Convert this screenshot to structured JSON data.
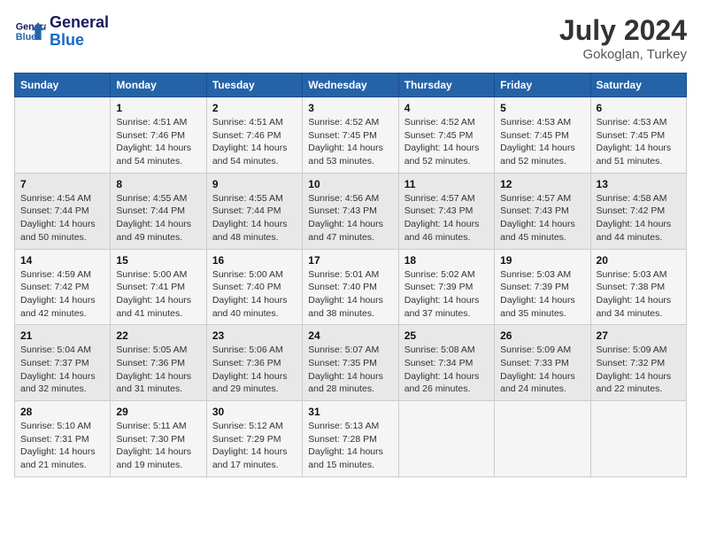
{
  "logo": {
    "line1": "General",
    "line2": "Blue"
  },
  "title": {
    "month_year": "July 2024",
    "location": "Gokoglan, Turkey"
  },
  "days_of_week": [
    "Sunday",
    "Monday",
    "Tuesday",
    "Wednesday",
    "Thursday",
    "Friday",
    "Saturday"
  ],
  "weeks": [
    [
      {
        "day": "",
        "sunrise": "",
        "sunset": "",
        "daylight": ""
      },
      {
        "day": "1",
        "sunrise": "Sunrise: 4:51 AM",
        "sunset": "Sunset: 7:46 PM",
        "daylight": "Daylight: 14 hours and 54 minutes."
      },
      {
        "day": "2",
        "sunrise": "Sunrise: 4:51 AM",
        "sunset": "Sunset: 7:46 PM",
        "daylight": "Daylight: 14 hours and 54 minutes."
      },
      {
        "day": "3",
        "sunrise": "Sunrise: 4:52 AM",
        "sunset": "Sunset: 7:45 PM",
        "daylight": "Daylight: 14 hours and 53 minutes."
      },
      {
        "day": "4",
        "sunrise": "Sunrise: 4:52 AM",
        "sunset": "Sunset: 7:45 PM",
        "daylight": "Daylight: 14 hours and 52 minutes."
      },
      {
        "day": "5",
        "sunrise": "Sunrise: 4:53 AM",
        "sunset": "Sunset: 7:45 PM",
        "daylight": "Daylight: 14 hours and 52 minutes."
      },
      {
        "day": "6",
        "sunrise": "Sunrise: 4:53 AM",
        "sunset": "Sunset: 7:45 PM",
        "daylight": "Daylight: 14 hours and 51 minutes."
      }
    ],
    [
      {
        "day": "7",
        "sunrise": "Sunrise: 4:54 AM",
        "sunset": "Sunset: 7:44 PM",
        "daylight": "Daylight: 14 hours and 50 minutes."
      },
      {
        "day": "8",
        "sunrise": "Sunrise: 4:55 AM",
        "sunset": "Sunset: 7:44 PM",
        "daylight": "Daylight: 14 hours and 49 minutes."
      },
      {
        "day": "9",
        "sunrise": "Sunrise: 4:55 AM",
        "sunset": "Sunset: 7:44 PM",
        "daylight": "Daylight: 14 hours and 48 minutes."
      },
      {
        "day": "10",
        "sunrise": "Sunrise: 4:56 AM",
        "sunset": "Sunset: 7:43 PM",
        "daylight": "Daylight: 14 hours and 47 minutes."
      },
      {
        "day": "11",
        "sunrise": "Sunrise: 4:57 AM",
        "sunset": "Sunset: 7:43 PM",
        "daylight": "Daylight: 14 hours and 46 minutes."
      },
      {
        "day": "12",
        "sunrise": "Sunrise: 4:57 AM",
        "sunset": "Sunset: 7:43 PM",
        "daylight": "Daylight: 14 hours and 45 minutes."
      },
      {
        "day": "13",
        "sunrise": "Sunrise: 4:58 AM",
        "sunset": "Sunset: 7:42 PM",
        "daylight": "Daylight: 14 hours and 44 minutes."
      }
    ],
    [
      {
        "day": "14",
        "sunrise": "Sunrise: 4:59 AM",
        "sunset": "Sunset: 7:42 PM",
        "daylight": "Daylight: 14 hours and 42 minutes."
      },
      {
        "day": "15",
        "sunrise": "Sunrise: 5:00 AM",
        "sunset": "Sunset: 7:41 PM",
        "daylight": "Daylight: 14 hours and 41 minutes."
      },
      {
        "day": "16",
        "sunrise": "Sunrise: 5:00 AM",
        "sunset": "Sunset: 7:40 PM",
        "daylight": "Daylight: 14 hours and 40 minutes."
      },
      {
        "day": "17",
        "sunrise": "Sunrise: 5:01 AM",
        "sunset": "Sunset: 7:40 PM",
        "daylight": "Daylight: 14 hours and 38 minutes."
      },
      {
        "day": "18",
        "sunrise": "Sunrise: 5:02 AM",
        "sunset": "Sunset: 7:39 PM",
        "daylight": "Daylight: 14 hours and 37 minutes."
      },
      {
        "day": "19",
        "sunrise": "Sunrise: 5:03 AM",
        "sunset": "Sunset: 7:39 PM",
        "daylight": "Daylight: 14 hours and 35 minutes."
      },
      {
        "day": "20",
        "sunrise": "Sunrise: 5:03 AM",
        "sunset": "Sunset: 7:38 PM",
        "daylight": "Daylight: 14 hours and 34 minutes."
      }
    ],
    [
      {
        "day": "21",
        "sunrise": "Sunrise: 5:04 AM",
        "sunset": "Sunset: 7:37 PM",
        "daylight": "Daylight: 14 hours and 32 minutes."
      },
      {
        "day": "22",
        "sunrise": "Sunrise: 5:05 AM",
        "sunset": "Sunset: 7:36 PM",
        "daylight": "Daylight: 14 hours and 31 minutes."
      },
      {
        "day": "23",
        "sunrise": "Sunrise: 5:06 AM",
        "sunset": "Sunset: 7:36 PM",
        "daylight": "Daylight: 14 hours and 29 minutes."
      },
      {
        "day": "24",
        "sunrise": "Sunrise: 5:07 AM",
        "sunset": "Sunset: 7:35 PM",
        "daylight": "Daylight: 14 hours and 28 minutes."
      },
      {
        "day": "25",
        "sunrise": "Sunrise: 5:08 AM",
        "sunset": "Sunset: 7:34 PM",
        "daylight": "Daylight: 14 hours and 26 minutes."
      },
      {
        "day": "26",
        "sunrise": "Sunrise: 5:09 AM",
        "sunset": "Sunset: 7:33 PM",
        "daylight": "Daylight: 14 hours and 24 minutes."
      },
      {
        "day": "27",
        "sunrise": "Sunrise: 5:09 AM",
        "sunset": "Sunset: 7:32 PM",
        "daylight": "Daylight: 14 hours and 22 minutes."
      }
    ],
    [
      {
        "day": "28",
        "sunrise": "Sunrise: 5:10 AM",
        "sunset": "Sunset: 7:31 PM",
        "daylight": "Daylight: 14 hours and 21 minutes."
      },
      {
        "day": "29",
        "sunrise": "Sunrise: 5:11 AM",
        "sunset": "Sunset: 7:30 PM",
        "daylight": "Daylight: 14 hours and 19 minutes."
      },
      {
        "day": "30",
        "sunrise": "Sunrise: 5:12 AM",
        "sunset": "Sunset: 7:29 PM",
        "daylight": "Daylight: 14 hours and 17 minutes."
      },
      {
        "day": "31",
        "sunrise": "Sunrise: 5:13 AM",
        "sunset": "Sunset: 7:28 PM",
        "daylight": "Daylight: 14 hours and 15 minutes."
      },
      {
        "day": "",
        "sunrise": "",
        "sunset": "",
        "daylight": ""
      },
      {
        "day": "",
        "sunrise": "",
        "sunset": "",
        "daylight": ""
      },
      {
        "day": "",
        "sunrise": "",
        "sunset": "",
        "daylight": ""
      }
    ]
  ]
}
